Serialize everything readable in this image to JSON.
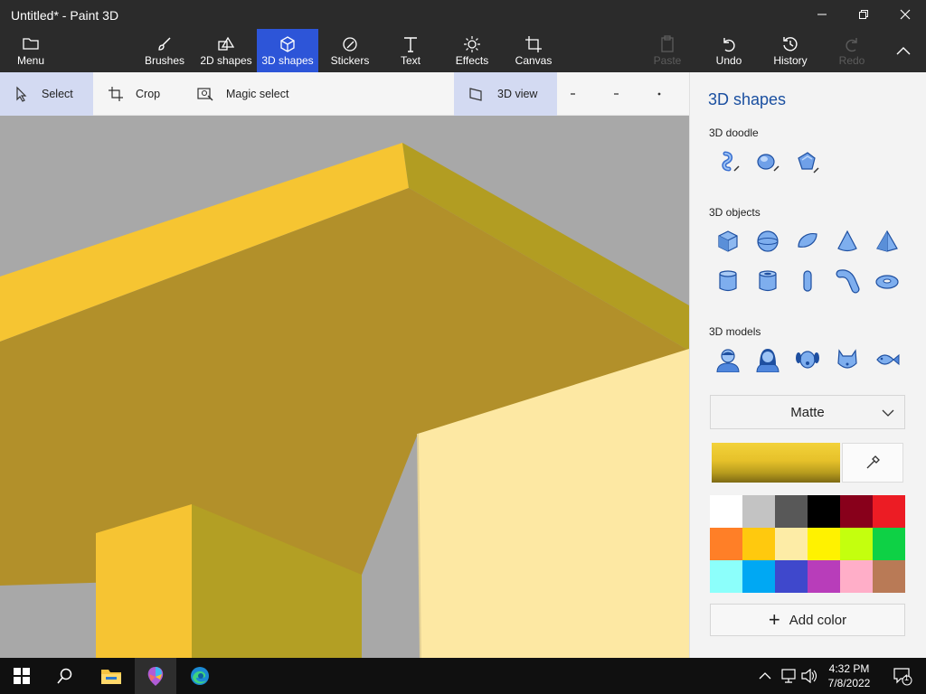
{
  "window": {
    "title": "Untitled* - Paint 3D"
  },
  "ribbon": {
    "menu_label": "Menu",
    "tabs": [
      {
        "label": "Brushes"
      },
      {
        "label": "2D shapes"
      },
      {
        "label": "3D shapes",
        "active": true
      },
      {
        "label": "Stickers"
      },
      {
        "label": "Text"
      },
      {
        "label": "Effects"
      },
      {
        "label": "Canvas"
      }
    ],
    "actions": [
      {
        "label": "Paste",
        "enabled": false
      },
      {
        "label": "Undo",
        "enabled": true
      },
      {
        "label": "History",
        "enabled": true
      },
      {
        "label": "Redo",
        "enabled": false
      }
    ]
  },
  "toolbar": {
    "select_label": "Select",
    "crop_label": "Crop",
    "magic_select_label": "Magic select",
    "view_label": "3D view"
  },
  "panel": {
    "title": "3D shapes",
    "doodle_heading": "3D doodle",
    "objects_heading": "3D objects",
    "models_heading": "3D models",
    "material": "Matte",
    "add_color_label": "Add color",
    "palette": [
      "#ffffff",
      "#c3c3c3",
      "#585858",
      "#000000",
      "#88001b",
      "#ec1c24",
      "#ff7f27",
      "#ffc90e",
      "#fdeca6",
      "#fff200",
      "#c4ff0e",
      "#0ed145",
      "#8cfffb",
      "#00a8f3",
      "#3f48cc",
      "#b83dba",
      "#ffaec8",
      "#b97a56"
    ],
    "current_color": "#e6c12a"
  },
  "taskbar": {
    "time": "4:32 PM",
    "date": "7/8/2022",
    "notification_count": "1"
  }
}
